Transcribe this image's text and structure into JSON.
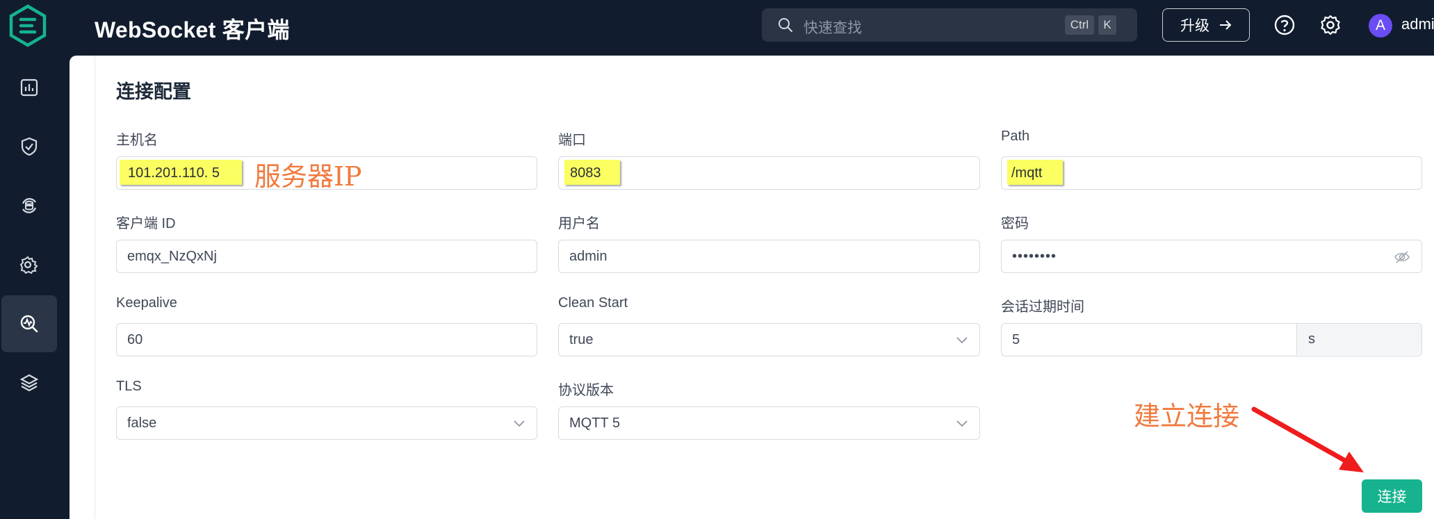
{
  "header": {
    "title": "WebSocket 客户端",
    "search_placeholder": "快速查找",
    "kbd_ctrl": "Ctrl",
    "kbd_k": "K",
    "upgrade_label": "升级",
    "avatar_letter": "A",
    "username": "admi"
  },
  "section": {
    "title": "连接配置"
  },
  "form": {
    "host": {
      "label": "主机名",
      "value": "101.201.110. 5"
    },
    "port": {
      "label": "端口",
      "value": "8083"
    },
    "path": {
      "label": "Path",
      "value": "/mqtt"
    },
    "client_id": {
      "label": "客户端 ID",
      "value": "emqx_NzQxNj"
    },
    "username": {
      "label": "用户名",
      "value": "admin"
    },
    "password": {
      "label": "密码",
      "value": "••••••••"
    },
    "keepalive": {
      "label": "Keepalive",
      "value": "60"
    },
    "clean_start": {
      "label": "Clean Start",
      "value": "true"
    },
    "session_expiry": {
      "label": "会话过期时间",
      "value": "5",
      "unit": "s"
    },
    "tls": {
      "label": "TLS",
      "value": "false"
    },
    "protocol": {
      "label": "协议版本",
      "value": "MQTT 5"
    }
  },
  "annotations": {
    "server_ip": "服务器IP",
    "connect_hint": "建立连接"
  },
  "actions": {
    "connect_label": "连接"
  },
  "colors": {
    "sidebar_bg": "#111d2e",
    "accent": "#16b38e",
    "highlight": "#fbff61",
    "annotation": "#f07a3e",
    "arrow": "#ee1c1c"
  }
}
